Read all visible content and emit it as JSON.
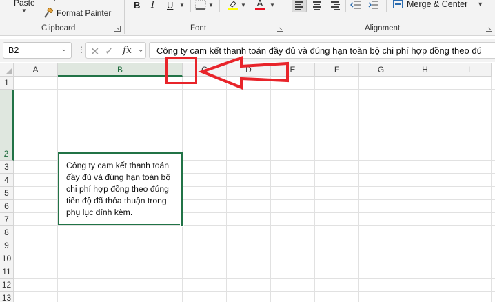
{
  "ribbon": {
    "paste_label": "Paste",
    "format_painter_label": "Format Painter",
    "groups": {
      "clipboard": "Clipboard",
      "font": "Font",
      "alignment": "Alignment"
    },
    "font_buttons": {
      "bold": "B",
      "italic": "I",
      "underline": "U",
      "font_color_letter": "A"
    },
    "merge_center_label": "Merge & Center"
  },
  "formula_bar": {
    "name_box": "B2",
    "fx_label": "fx",
    "formula_text": "Công ty cam kết thanh toán đầy đủ và đúng hạn toàn bộ chi phí hợp đồng theo đú"
  },
  "grid": {
    "columns": [
      "A",
      "B",
      "C",
      "D",
      "E",
      "F",
      "G",
      "H",
      "I"
    ],
    "rows": [
      "1",
      "2",
      "3",
      "4",
      "5",
      "6",
      "7",
      "8",
      "9",
      "10",
      "11",
      "12",
      "13"
    ],
    "active_cell_lines": [
      "Công ty cam kết thanh toán",
      "đầy đủ và đúng hạn toàn bộ",
      "chi phí hợp đồng theo đúng",
      "tiến độ đã thỏa thuận trong",
      "phụ lục đính kèm."
    ]
  },
  "colors": {
    "accent_green": "#217346",
    "annotation_red": "#e8242a",
    "font_color_bar": "#e81123",
    "highlight_bar": "#ffff00"
  },
  "icons": [
    "paintbrush-icon",
    "borders-icon",
    "highlighter-icon",
    "font-color-icon",
    "align-left-icon",
    "align-center-icon",
    "align-right-icon",
    "decrease-indent-icon",
    "increase-indent-icon",
    "merge-icon",
    "cancel-icon",
    "enter-icon",
    "dialog-launcher-icon"
  ]
}
